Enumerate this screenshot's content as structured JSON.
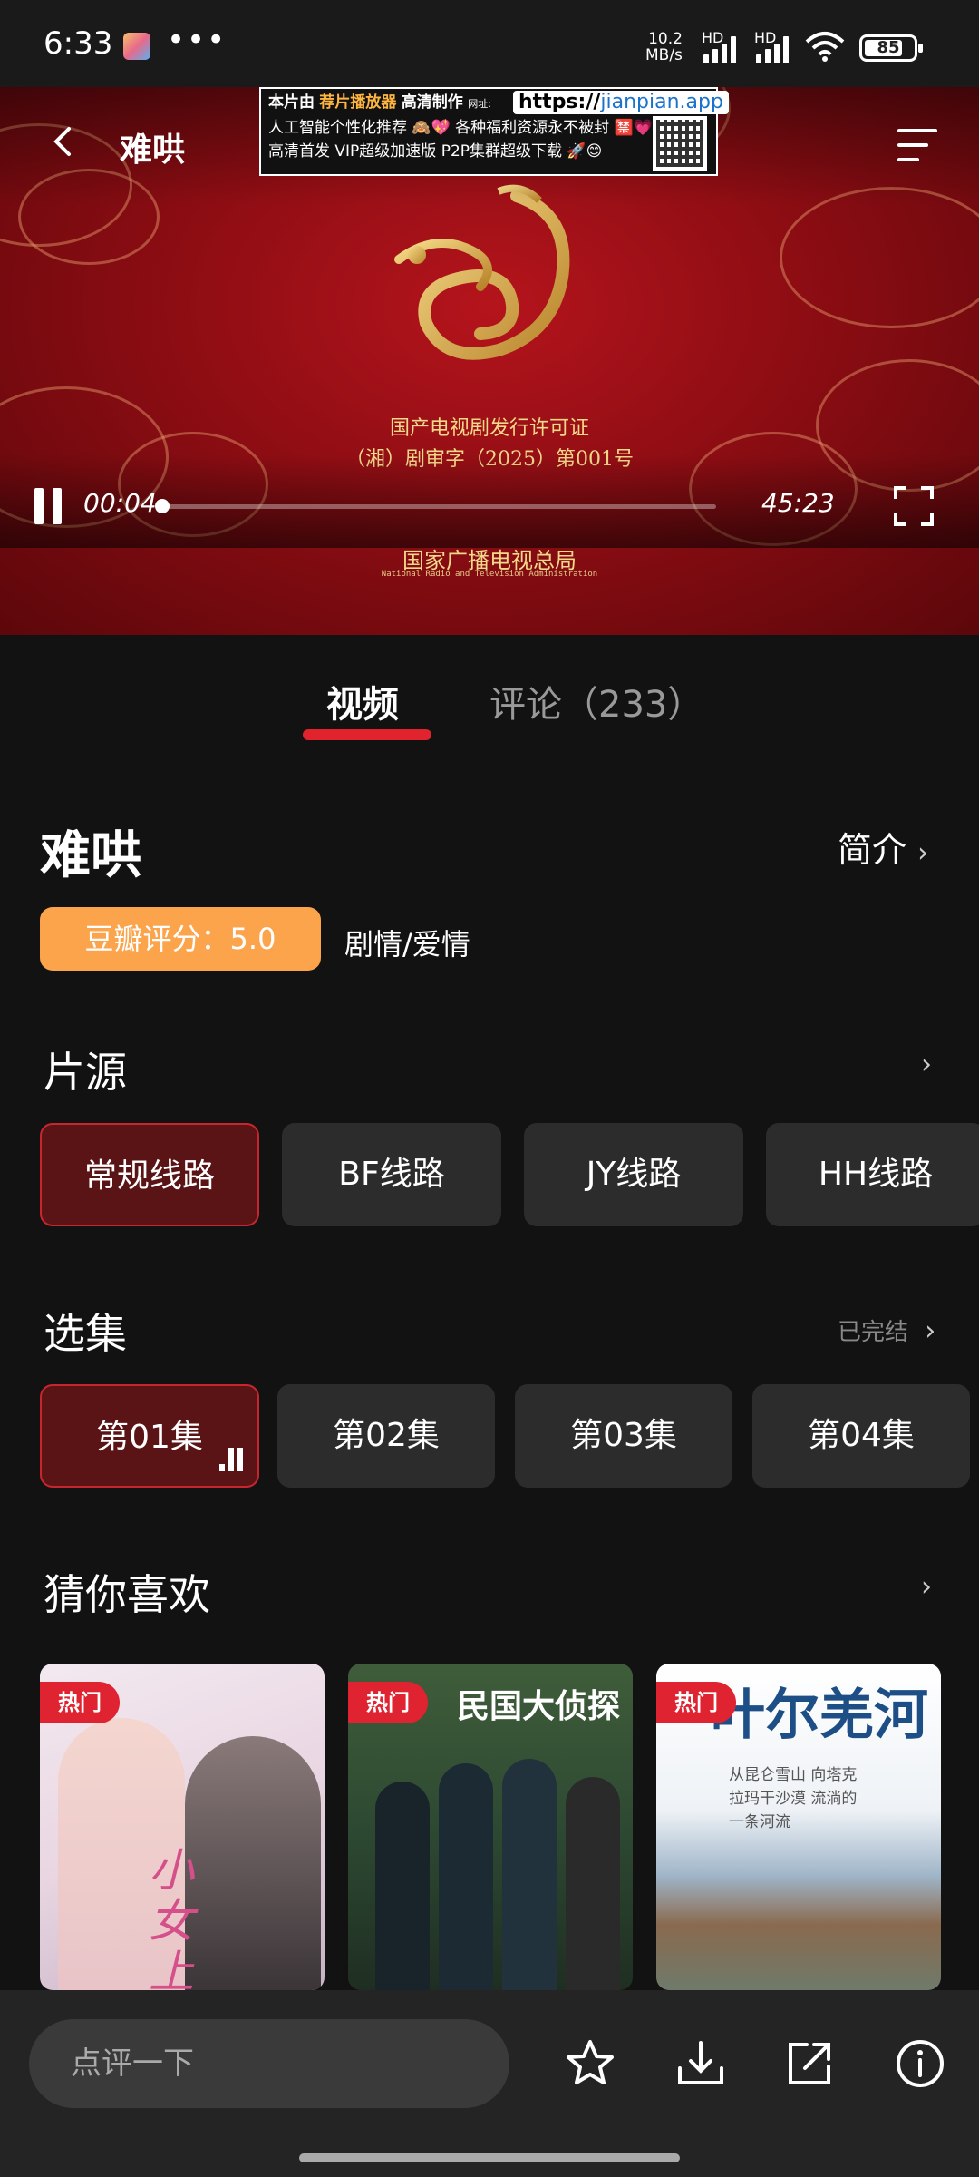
{
  "status_bar": {
    "time": "6:33",
    "net_speed_value": "10.2",
    "net_speed_unit": "MB/s",
    "hd_label": "HD",
    "battery": "85"
  },
  "player": {
    "title": "难哄",
    "ad": {
      "line1_prefix": "本片由",
      "line1_brand": "荐片播放器",
      "line1_suffix": "高清制作",
      "site_label": "网址:",
      "url_prefix": "https://",
      "url_domain": "jianpian.app",
      "line2": "人工智能个性化推荐 🙈💖  各种福利资源永不被封 🈲💗",
      "line3": "高清首发  VIP超级加速版  P2P集群超级下载 🚀😊"
    },
    "license_line1": "国产电视剧发行许可证",
    "license_line2": "（湘）剧审字（2025）第001号",
    "agency_cn": "国家广播电视总局",
    "agency_en": "National Radio and Television Administration",
    "current_time": "00:04",
    "duration": "45:23",
    "progress": 0.0015
  },
  "tabs": {
    "video": "视频",
    "comments": "评论（233）"
  },
  "show": {
    "title": "难哄",
    "intro_label": "简介",
    "rating": "豆瓣评分：5.0",
    "genre": "剧情/爱情"
  },
  "sources": {
    "heading": "片源",
    "items": [
      "常规线路",
      "BF线路",
      "JY线路",
      "HH线路"
    ]
  },
  "episodes": {
    "heading": "选集",
    "status": "已完结",
    "items": [
      "第01集",
      "第02集",
      "第03集",
      "第04集"
    ]
  },
  "recommend": {
    "heading": "猜你喜欢",
    "badge": "热门",
    "cards": [
      {
        "poster_text": "小女上房揭"
      },
      {
        "poster_text": "民国大侦探"
      },
      {
        "poster_text": "叶尔羌河",
        "poster_sub": "从昆仑雪山 向塔克拉玛干沙漠 流淌的一条河流"
      }
    ]
  },
  "bottom": {
    "comment_placeholder": "点评一下"
  },
  "colors": {
    "accent": "#e0232d",
    "rating_bg": "#fba44c",
    "active_chip_bg": "#5a1416"
  }
}
